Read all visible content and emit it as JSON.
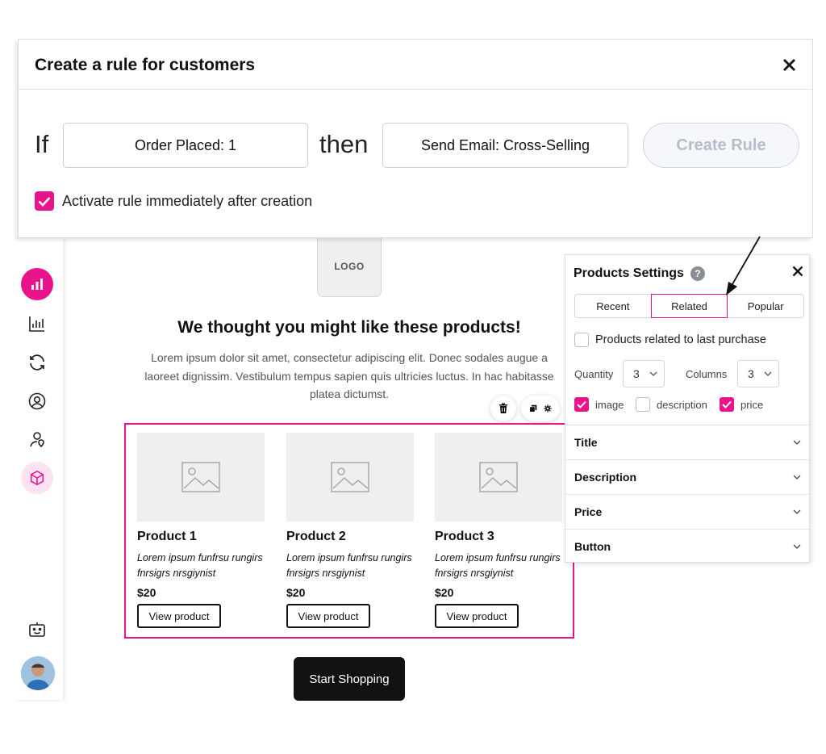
{
  "dialog": {
    "title": "Create a rule for customers",
    "if_label": "If",
    "condition_value": "Order Placed: 1",
    "then_label": "then",
    "action_value": "Send Email: Cross-Selling",
    "create_button": "Create Rule",
    "activate_label": "Activate rule immediately after creation",
    "activate_checked": true
  },
  "sidebar": {
    "items": [
      {
        "icon": "bar-chart-icon",
        "active": true
      },
      {
        "icon": "analytics-icon",
        "active": false
      },
      {
        "icon": "sync-icon",
        "active": false
      },
      {
        "icon": "user-circle-icon",
        "active": false
      },
      {
        "icon": "user-pin-icon",
        "active": false
      },
      {
        "icon": "cube-icon",
        "active": true
      }
    ],
    "bottom": [
      {
        "icon": "bot-icon"
      },
      {
        "icon": "avatar"
      }
    ]
  },
  "email": {
    "logo": "LOGO",
    "heading": "We thought you might like these products!",
    "body": "Lorem ipsum dolor sit amet, consectetur adipiscing elit. Donec sodales augue a laoreet dignissim. Vestibulum tempus sapien quis ultricies luctus. In hac habitasse platea dictumst.",
    "products": [
      {
        "name": "Product 1",
        "desc": "Lorem ipsum funfrsu rungirs fnrsigrs nrsgiynist",
        "price": "$20",
        "button": "View product"
      },
      {
        "name": "Product 2",
        "desc": "Lorem ipsum funfrsu rungirs fnrsigrs nrsgiynist",
        "price": "$20",
        "button": "View product"
      },
      {
        "name": "Product 3",
        "desc": "Lorem ipsum funfrsu rungirs fnrsigrs nrsgiynist",
        "price": "$20",
        "button": "View product"
      }
    ],
    "cta": "Start Shopping"
  },
  "settings": {
    "title": "Products Settings",
    "help": "?",
    "tabs": [
      "Recent",
      "Related",
      "Popular"
    ],
    "active_tab": "Related",
    "related_label": "Products related to last purchase",
    "related_checked": false,
    "quantity_label": "Quantity",
    "quantity_value": "3",
    "columns_label": "Columns",
    "columns_value": "3",
    "options": [
      {
        "label": "image",
        "checked": true
      },
      {
        "label": "description",
        "checked": false
      },
      {
        "label": "price",
        "checked": true
      }
    ],
    "sections": [
      "Title",
      "Description",
      "Price",
      "Button"
    ]
  },
  "colors": {
    "accent": "#e9138a",
    "dark": "#111111",
    "muted": "#b8bcc8"
  }
}
